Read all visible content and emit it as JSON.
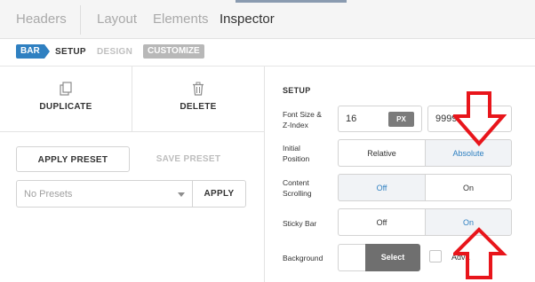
{
  "top_tabs": [
    {
      "label": "Headers"
    },
    {
      "label": "Layout"
    },
    {
      "label": "Elements"
    },
    {
      "label": "Inspector"
    }
  ],
  "subnav": {
    "bar_badge": "BAR",
    "setup": "SETUP",
    "design": "DESIGN",
    "customize": "CUSTOMIZE"
  },
  "actions": {
    "duplicate": "DUPLICATE",
    "delete": "DELETE"
  },
  "presets": {
    "apply_preset": "APPLY PRESET",
    "save_preset": "SAVE PRESET",
    "select_value": "No Presets",
    "apply": "APPLY"
  },
  "setup": {
    "title": "SETUP",
    "font_size_label_1": "Font Size &",
    "font_size_label_2": "Z-Index",
    "font_size_value": "16",
    "font_size_unit": "PX",
    "z_index_value": "9999",
    "initial_position_label_1": "Initial",
    "initial_position_label_2": "Position",
    "position_options": [
      "Relative",
      "Absolute"
    ],
    "position_selected": "Absolute",
    "content_scrolling_label_1": "Content",
    "content_scrolling_label_2": "Scrolling",
    "scrolling_options": [
      "Off",
      "On"
    ],
    "scrolling_selected": "Off",
    "sticky_bar_label": "Sticky Bar",
    "sticky_options": [
      "Off",
      "On"
    ],
    "sticky_selected": "On",
    "background_label": "Background",
    "background_select": "Select",
    "advanced_label": "Adva"
  },
  "colors": {
    "accent": "#2f80c1",
    "annotation_arrow": "#e8151b",
    "select_button": "#6f6f6f"
  }
}
